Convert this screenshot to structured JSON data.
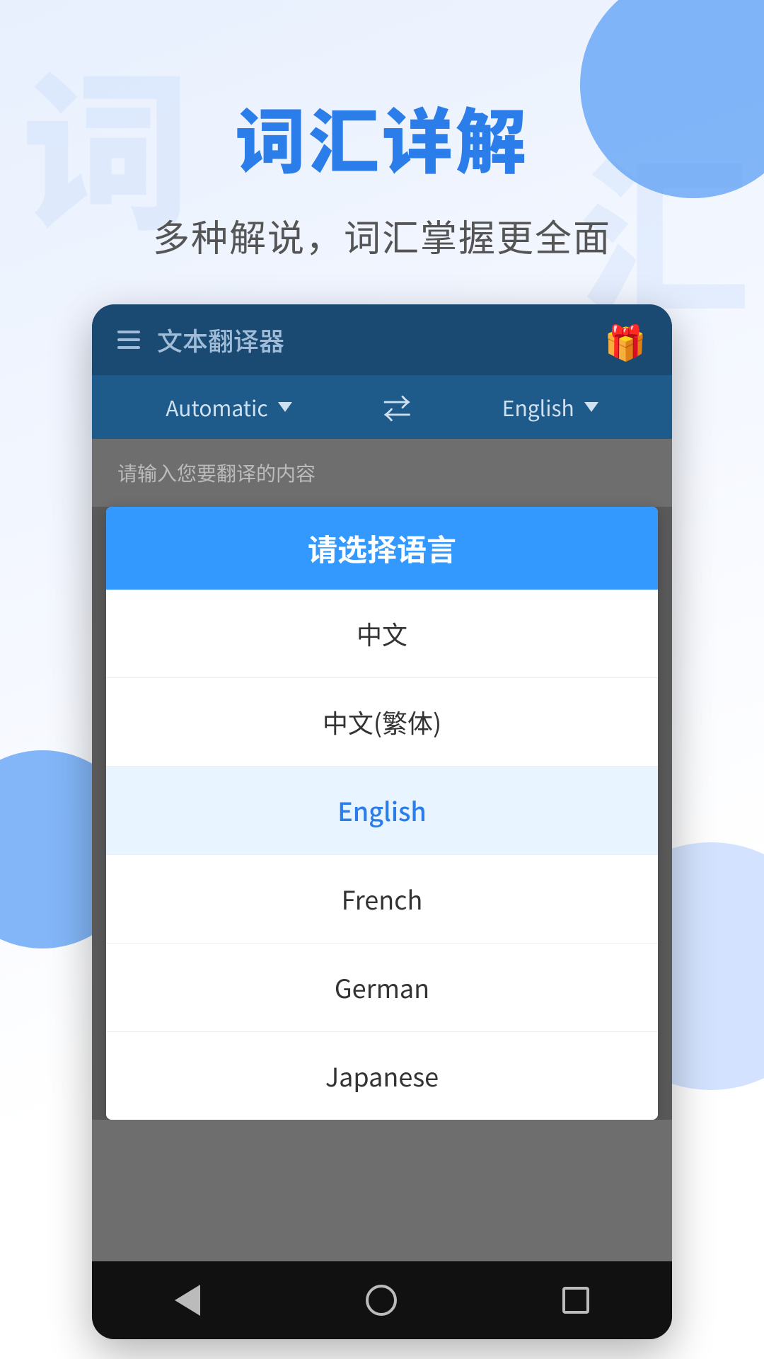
{
  "promo": {
    "title": "词汇详解",
    "subtitle": "多种解说，词汇掌握更全面"
  },
  "watermark": {
    "left": "词",
    "right": "汇"
  },
  "toolbar": {
    "title": "文本翻译器",
    "gift_icon": "🎁"
  },
  "lang_bar": {
    "source_lang": "Automatic",
    "target_lang": "English",
    "swap_symbol": "⇄"
  },
  "text_input": {
    "placeholder": "请输入您要翻译的内容"
  },
  "dialog": {
    "title": "请选择语言",
    "items": [
      {
        "label": "中文",
        "highlighted": false
      },
      {
        "label": "中文(繁体)",
        "highlighted": false
      },
      {
        "label": "English",
        "highlighted": true
      },
      {
        "label": "French",
        "highlighted": false
      },
      {
        "label": "German",
        "highlighted": false
      },
      {
        "label": "Japanese",
        "highlighted": false
      }
    ]
  }
}
